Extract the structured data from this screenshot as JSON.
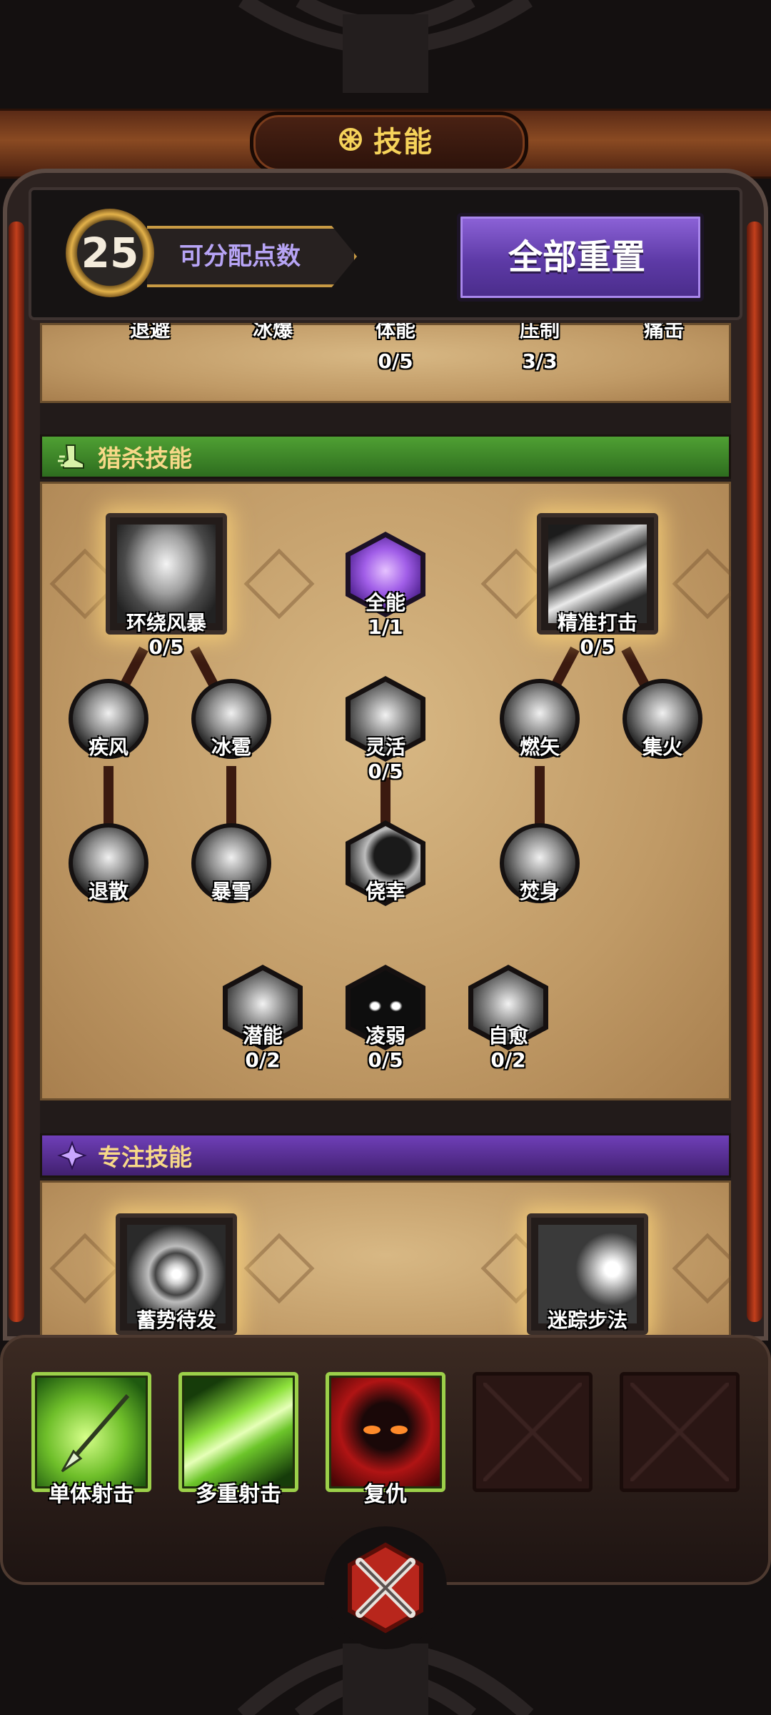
{
  "title": "技能",
  "header": {
    "level": "25",
    "points_label": "可分配点数",
    "reset_label": "全部重置"
  },
  "prev_section": {
    "partial_names": [
      "退避",
      "冰爆",
      "体能",
      "压制",
      "痛击"
    ],
    "counts": {
      "tineng": "0/5",
      "yazhi": "3/3"
    }
  },
  "hunt": {
    "title": "猎杀技能",
    "huanrao": {
      "name": "环绕风暴",
      "count": "0/5"
    },
    "quanneng": {
      "name": "全能",
      "count": "1/1"
    },
    "jingzhun": {
      "name": "精准打击",
      "count": "0/5"
    },
    "jifeng": {
      "name": "疾风"
    },
    "bingbao": {
      "name": "冰雹"
    },
    "linghuo": {
      "name": "灵活",
      "count": "0/5"
    },
    "ranshi": {
      "name": "燃矢"
    },
    "jihuo": {
      "name": "集火"
    },
    "tuisan": {
      "name": "退散"
    },
    "baoxue": {
      "name": "暴雪"
    },
    "jiaoxing": {
      "name": "侥幸"
    },
    "fenshen": {
      "name": "焚身"
    },
    "qianneng": {
      "name": "潜能",
      "count": "0/2"
    },
    "lingruo": {
      "name": "凌弱",
      "count": "0/5"
    },
    "ziyu": {
      "name": "自愈",
      "count": "0/2"
    }
  },
  "focus": {
    "title": "专注技能",
    "xushi": {
      "name": "蓄势待发"
    },
    "mizong": {
      "name": "迷踪步法"
    }
  },
  "equipped": {
    "slot1": "单体射击",
    "slot2": "多重射击",
    "slot3": "复仇"
  },
  "colors": {
    "hunt_banner": "#3f8a2a",
    "focus_banner": "#5a3196",
    "accent_gold": "#f6d35a",
    "points_text": "#b7a4f5"
  },
  "icons": {
    "title": "gear-icon",
    "hunt": "boot-icon",
    "focus": "star-icon",
    "close": "crossed-swords-icon"
  }
}
